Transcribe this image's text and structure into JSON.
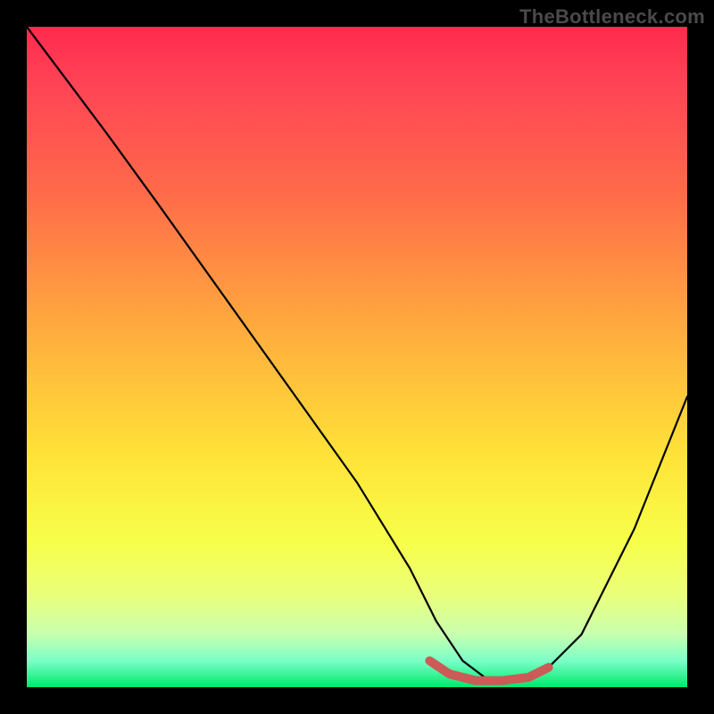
{
  "watermark": "TheBottleneck.com",
  "chart_data": {
    "type": "line",
    "title": "",
    "xlabel": "",
    "ylabel": "",
    "xlim": [
      0,
      100
    ],
    "ylim": [
      0,
      100
    ],
    "background": "rainbow-gradient",
    "series": [
      {
        "name": "bottleneck-curve",
        "x": [
          0,
          6,
          12,
          20,
          30,
          40,
          50,
          58,
          62,
          66,
          70,
          74,
          78,
          84,
          92,
          100
        ],
        "y": [
          100,
          92,
          84,
          73,
          59,
          45,
          31,
          18,
          10,
          4,
          1,
          1,
          2,
          8,
          24,
          44
        ]
      }
    ],
    "highlight_segment": {
      "name": "optimal-range",
      "color": "#cc5a56",
      "x": [
        61,
        64,
        68,
        72,
        76,
        79
      ],
      "y": [
        4,
        2,
        1,
        1,
        1.5,
        3
      ]
    }
  }
}
